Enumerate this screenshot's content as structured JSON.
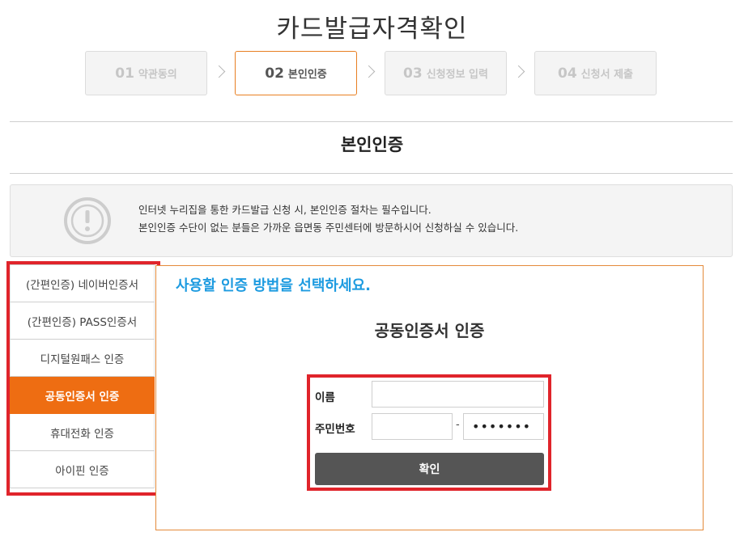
{
  "page": {
    "title": "카드발급자격확인"
  },
  "steps": [
    {
      "num": "01",
      "label": "약관동의"
    },
    {
      "num": "02",
      "label": "본인인증"
    },
    {
      "num": "03",
      "label": "신청정보 입력"
    },
    {
      "num": "04",
      "label": "신청서 제출"
    }
  ],
  "active_step": "02",
  "section": {
    "title": "본인인증"
  },
  "notice": {
    "icon": "exclamation-circle-icon",
    "line1": "인터넷 누리집을 통한 카드발급 신청 시, 본인인증 절차는 필수입니다.",
    "line2": "본인인증 수단이 없는 분들은 가까운 읍면동 주민센터에 방문하시어 신청하실 수 있습니다."
  },
  "auth_menu": {
    "items": [
      {
        "label": "(간편인증) 네이버인증서"
      },
      {
        "label": "(간편인증) PASS인증서"
      },
      {
        "label": "디지털원패스 인증"
      },
      {
        "label": "공동인증서 인증"
      },
      {
        "label": "휴대전화 인증"
      },
      {
        "label": "아이핀 인증"
      }
    ],
    "selected": "공동인증서 인증"
  },
  "panel": {
    "guide": "사용할 인증 방법을 선택하세요.",
    "title": "공동인증서 인증",
    "form": {
      "name_label": "이름",
      "name_value": "",
      "rrn_label": "주민번호",
      "rrn_front_value": "",
      "rrn_separator": "-",
      "rrn_back_value": "•••••••",
      "confirm_label": "확인"
    }
  },
  "colors": {
    "accent_orange": "#ee6d12",
    "highlight_red": "#e0242b",
    "guide_blue": "#1d9be0",
    "button_gray": "#555555"
  }
}
